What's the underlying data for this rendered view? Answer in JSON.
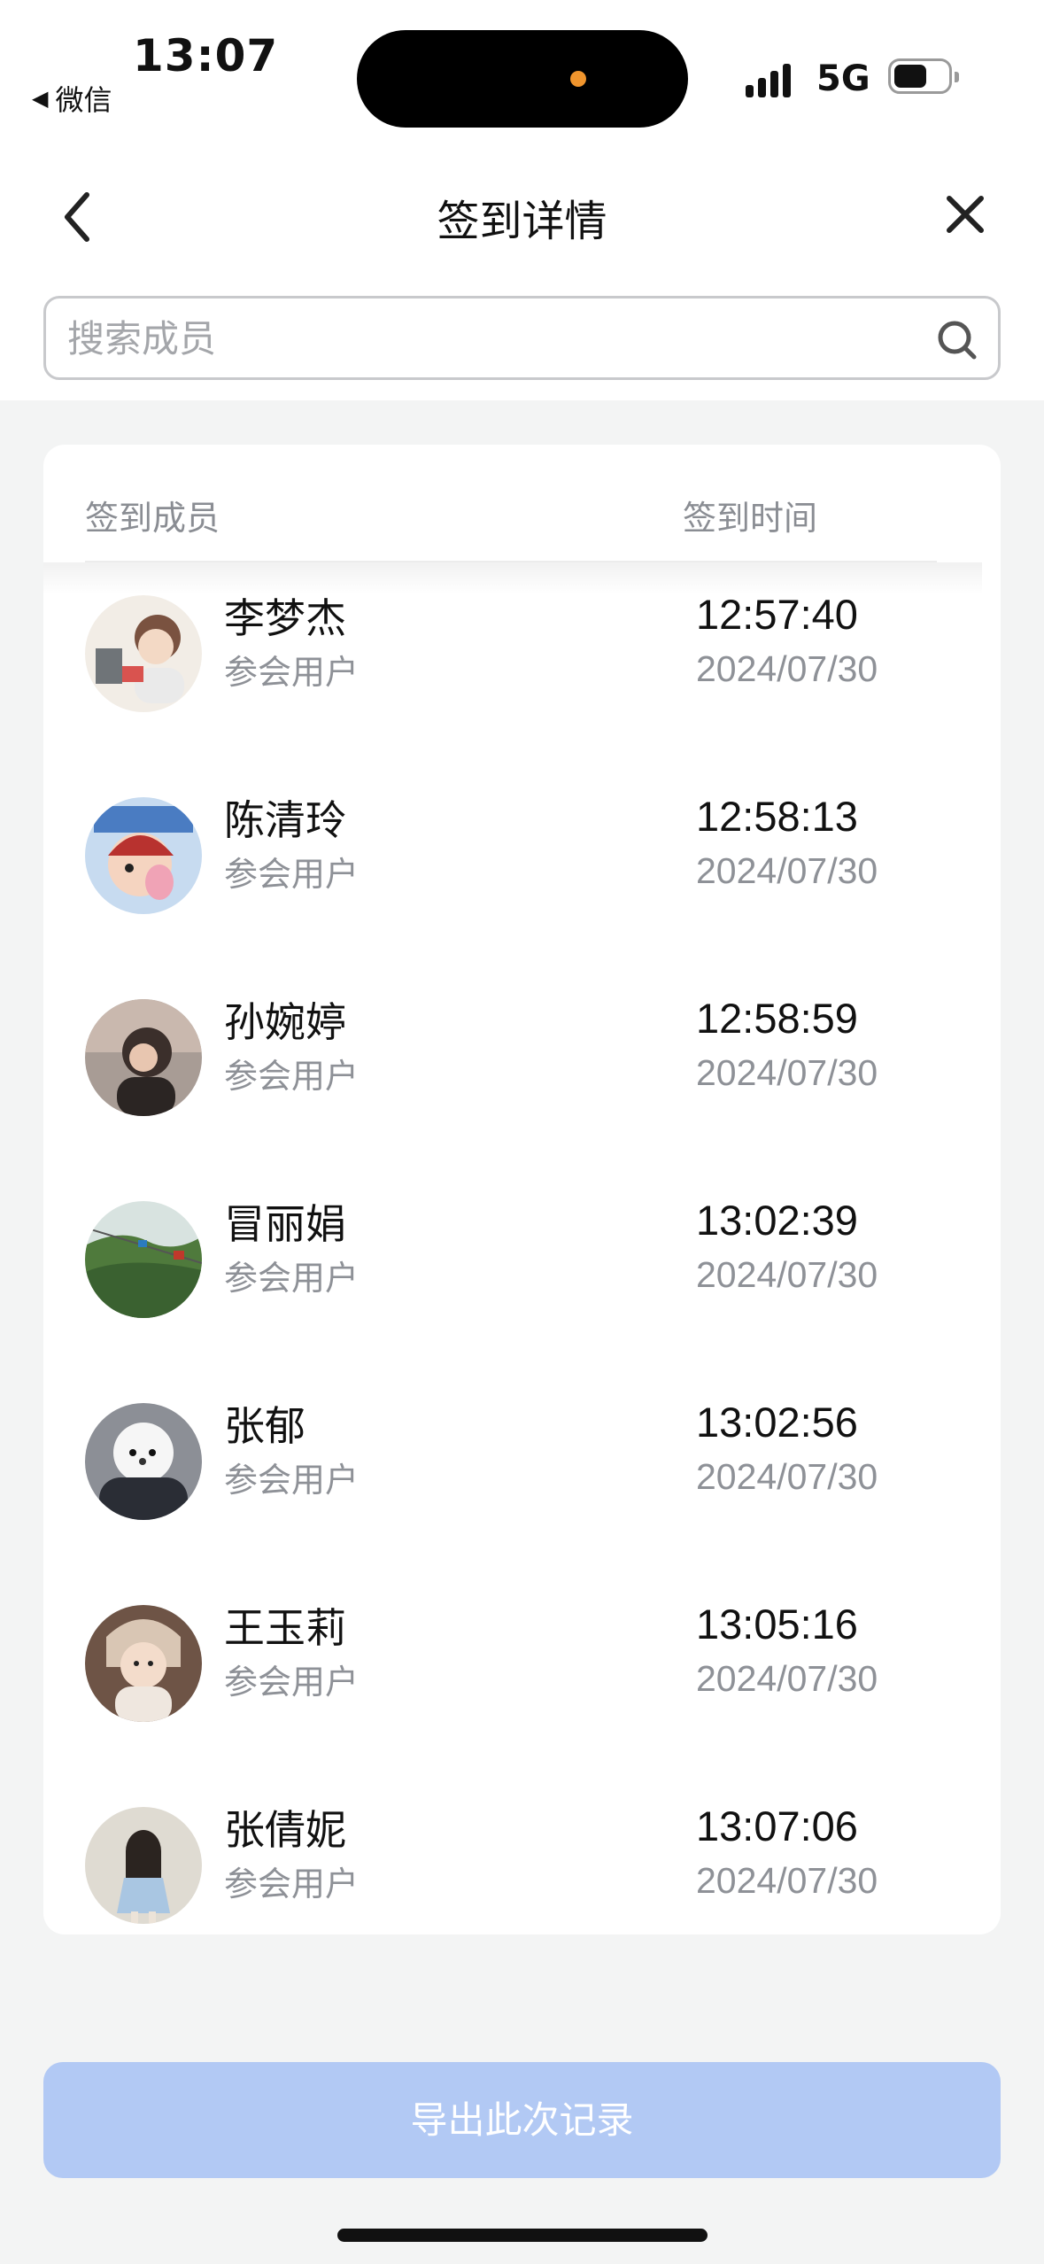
{
  "status_bar": {
    "time": "13:07",
    "back_app": "微信",
    "network": "5G"
  },
  "nav": {
    "title": "签到详情"
  },
  "search": {
    "placeholder": "搜索成员",
    "value": ""
  },
  "table": {
    "columns": [
      "签到成员",
      "签到时间"
    ],
    "rows": [
      {
        "name": "李梦杰",
        "role": "参会用户",
        "time": "12:57:40",
        "date": "2024/07/30"
      },
      {
        "name": "陈清玲",
        "role": "参会用户",
        "time": "12:58:13",
        "date": "2024/07/30"
      },
      {
        "name": "孙婉婷",
        "role": "参会用户",
        "time": "12:58:59",
        "date": "2024/07/30"
      },
      {
        "name": "冒丽娟",
        "role": "参会用户",
        "time": "13:02:39",
        "date": "2024/07/30"
      },
      {
        "name": "张郁",
        "role": "参会用户",
        "time": "13:02:56",
        "date": "2024/07/30"
      },
      {
        "name": "王玉莉",
        "role": "参会用户",
        "time": "13:05:16",
        "date": "2024/07/30"
      },
      {
        "name": "张倩妮",
        "role": "参会用户",
        "time": "13:07:06",
        "date": "2024/07/30"
      }
    ]
  },
  "footer": {
    "export_label": "导出此次记录"
  },
  "colors": {
    "primary_disabled": "#b2c9f4",
    "background": "#f3f4f4",
    "secondary_text": "#8e9197"
  }
}
